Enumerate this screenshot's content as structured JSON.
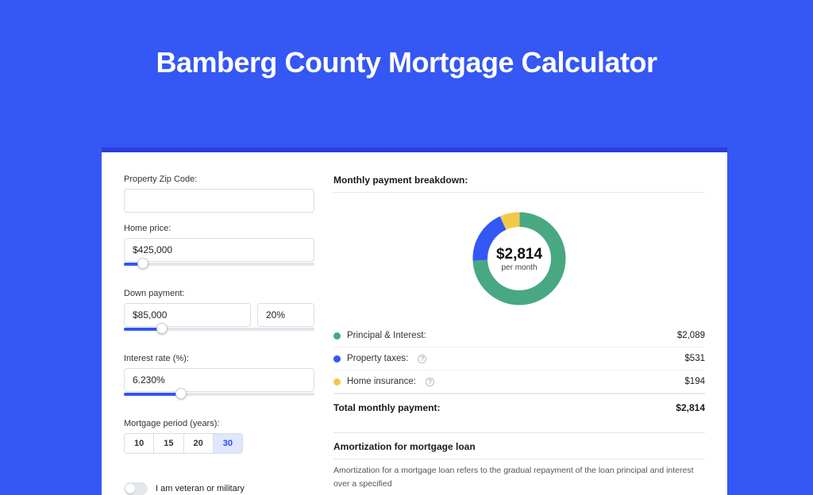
{
  "title": "Bamberg County Mortgage Calculator",
  "colors": {
    "principal": "#48a882",
    "taxes": "#3457F5",
    "insurance": "#f2c84b"
  },
  "form": {
    "zip": {
      "label": "Property Zip Code:",
      "value": ""
    },
    "homePrice": {
      "label": "Home price:",
      "value": "$425,000",
      "sliderPct": 10
    },
    "downPayment": {
      "label": "Down payment:",
      "value": "$85,000",
      "percent": "20%",
      "sliderPct": 20
    },
    "interest": {
      "label": "Interest rate (%):",
      "value": "6.230%",
      "sliderPct": 30
    },
    "period": {
      "label": "Mortgage period (years):",
      "options": [
        "10",
        "15",
        "20",
        "30"
      ],
      "selected": "30"
    },
    "veteran": {
      "label": "I am veteran or military",
      "on": false
    }
  },
  "breakdown": {
    "heading": "Monthly payment breakdown:",
    "center": {
      "amount": "$2,814",
      "sub": "per month"
    },
    "rows": [
      {
        "key": "principal",
        "label": "Principal & Interest:",
        "value": "$2,089",
        "info": false
      },
      {
        "key": "taxes",
        "label": "Property taxes:",
        "value": "$531",
        "info": true
      },
      {
        "key": "insurance",
        "label": "Home insurance:",
        "value": "$194",
        "info": true
      }
    ],
    "totalLabel": "Total monthly payment:",
    "totalValue": "$2,814"
  },
  "amort": {
    "heading": "Amortization for mortgage loan",
    "text": "Amortization for a mortgage loan refers to the gradual repayment of the loan principal and interest over a specified"
  },
  "chart_data": {
    "type": "pie",
    "title": "Monthly payment breakdown",
    "series": [
      {
        "name": "Principal & Interest",
        "value": 2089
      },
      {
        "name": "Property taxes",
        "value": 531
      },
      {
        "name": "Home insurance",
        "value": 194
      }
    ],
    "total": 2814,
    "unit": "USD per month"
  }
}
